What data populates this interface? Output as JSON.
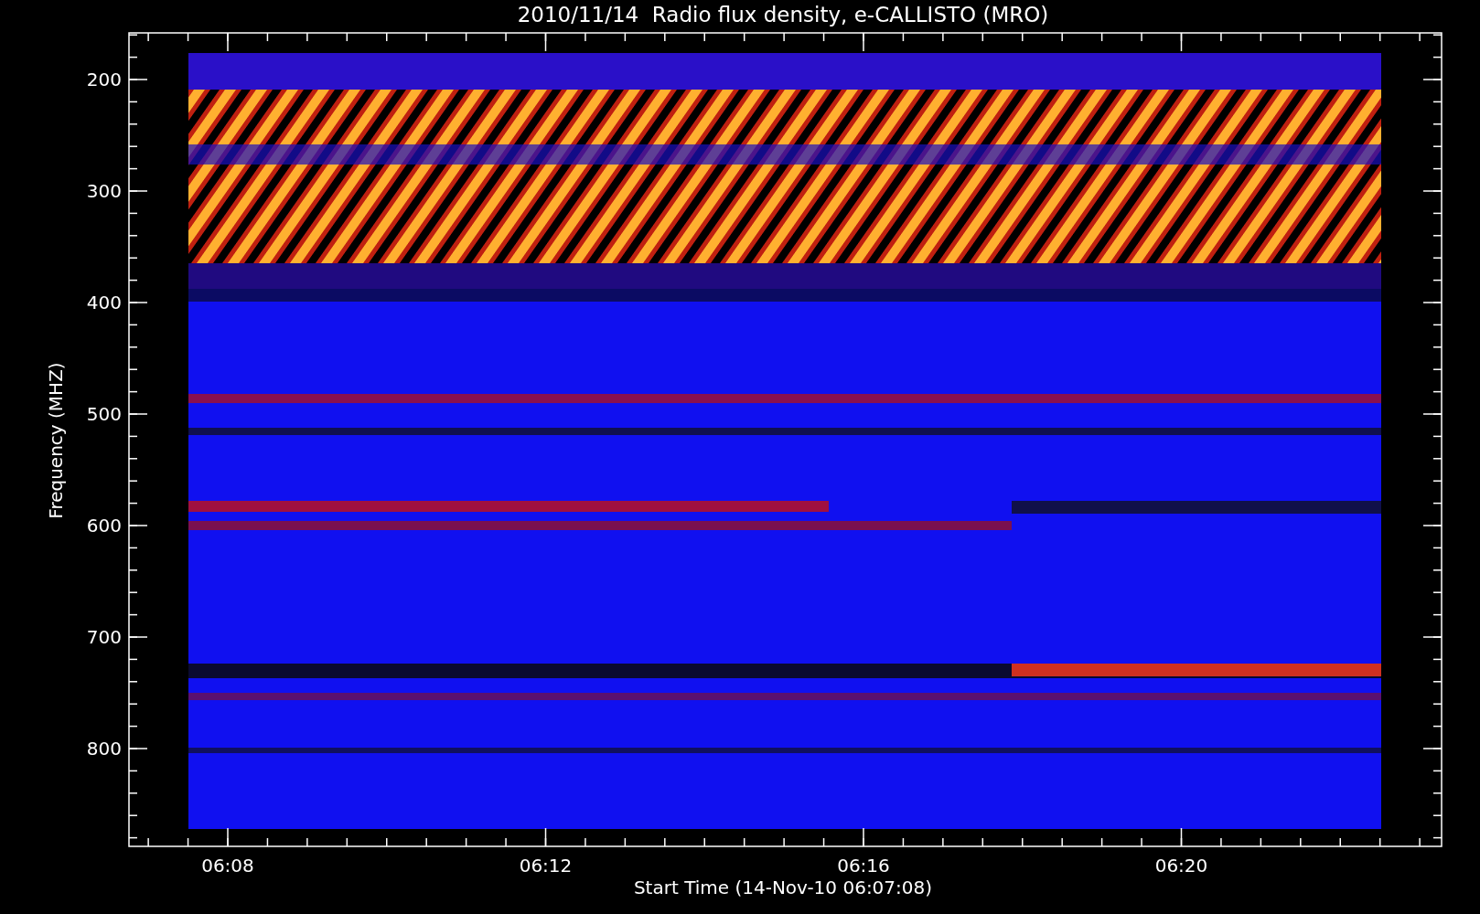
{
  "plot": {
    "title": "2010/11/14  Radio flux density, e-CALLISTO (MRO)",
    "ylabel": "Frequency (MHZ)",
    "xlabel": "Start Time (14-Nov-10 06:07:08)",
    "yticks": [
      "200",
      "300",
      "400",
      "500",
      "600",
      "700",
      "800"
    ],
    "xticks": [
      "06:08",
      "06:12",
      "06:16",
      "06:20"
    ]
  }
}
